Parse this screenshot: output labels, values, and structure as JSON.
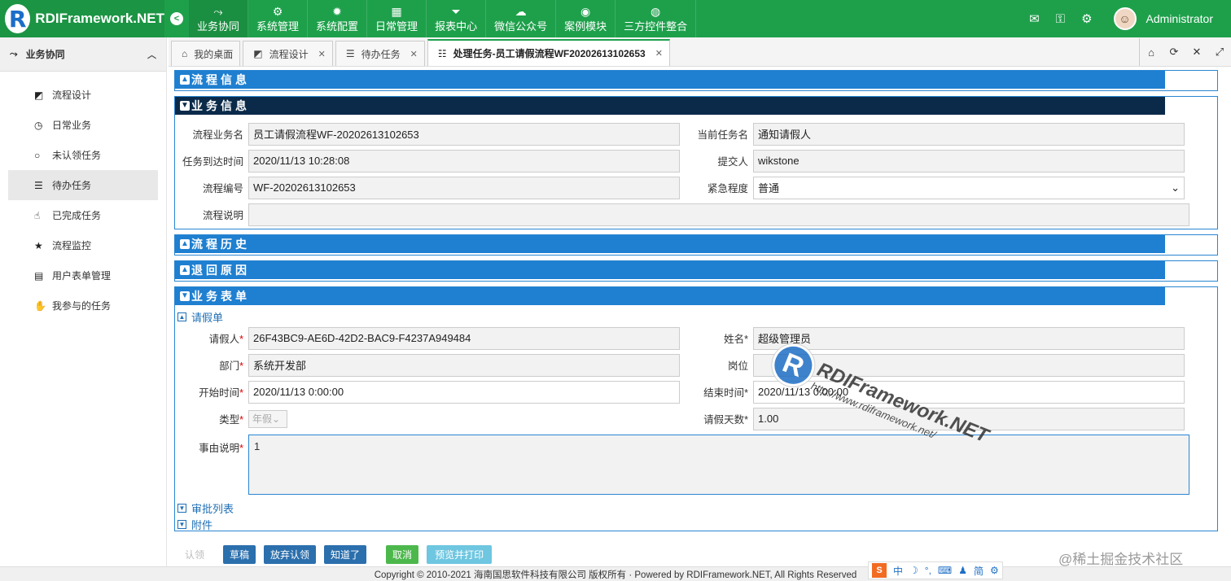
{
  "app": {
    "logo_letter": "R",
    "title": "RDIFramework.NET"
  },
  "nav": {
    "collapse_icon": "chevron-left",
    "items": [
      {
        "icon": "share-icon",
        "glyph": "⤳",
        "label": "业务协同",
        "active": true
      },
      {
        "icon": "cogs-icon",
        "glyph": "⚙",
        "label": "系统管理"
      },
      {
        "icon": "gear-icon",
        "glyph": "✹",
        "label": "系统配置"
      },
      {
        "icon": "calendar-icon",
        "glyph": "▦",
        "label": "日常管理"
      },
      {
        "icon": "filter-icon",
        "glyph": "⏷",
        "label": "报表中心"
      },
      {
        "icon": "wechat-icon",
        "glyph": "☁",
        "label": "微信公众号"
      },
      {
        "icon": "eye-icon",
        "glyph": "◉",
        "label": "案例模块"
      },
      {
        "icon": "globe-icon",
        "glyph": "◍",
        "label": "三方控件整合"
      }
    ],
    "right": {
      "mail": "✉",
      "key": "⚿",
      "settings": "⚙",
      "username": "Administrator"
    }
  },
  "sidebar": {
    "header": "业务协同",
    "items": [
      {
        "glyph": "◩",
        "label": "流程设计"
      },
      {
        "glyph": "◷",
        "label": "日常业务"
      },
      {
        "glyph": "○",
        "label": "未认领任务"
      },
      {
        "glyph": "☰",
        "label": "待办任务",
        "active": true
      },
      {
        "glyph": "☝",
        "label": "已完成任务"
      },
      {
        "glyph": "★",
        "label": "流程监控"
      },
      {
        "glyph": "▤",
        "label": "用户表单管理"
      },
      {
        "glyph": "✋",
        "label": "我参与的任务"
      }
    ]
  },
  "tabs": [
    {
      "glyph": "⌂",
      "label": "我的桌面",
      "closable": false
    },
    {
      "glyph": "◩",
      "label": "流程设计",
      "closable": true
    },
    {
      "glyph": "☰",
      "label": "待办任务",
      "closable": true
    },
    {
      "glyph": "☷",
      "label": "处理任务-员工请假流程WF20202613102653",
      "closable": true,
      "active": true
    }
  ],
  "tab_tools": [
    "⌂",
    "⟳",
    "✕",
    "⤢"
  ],
  "sections": {
    "flow_info": "流程信息",
    "biz_info": "业务信息",
    "flow_history": "流程历史",
    "return_reason": "退回原因",
    "biz_form": "业务表单"
  },
  "biz_info": {
    "flow_name_label": "流程业务名",
    "flow_name": "员工请假流程WF-20202613102653",
    "cur_task_label": "当前任务名",
    "cur_task": "通知请假人",
    "arrive_label": "任务到达时间",
    "arrive": "2020/11/13 10:28:08",
    "submitter_label": "提交人",
    "submitter": "wikstone",
    "flow_no_label": "流程编号",
    "flow_no": "WF-20202613102653",
    "urgency_label": "紧急程度",
    "urgency": "普通",
    "desc_label": "流程说明",
    "desc": ""
  },
  "leave_form": {
    "subsection": "请假单",
    "applicant_label": "请假人",
    "applicant": "26F43BC9-AE6D-42D2-BAC9-F4237A949484",
    "name_label": "姓名",
    "name": "超级管理员",
    "dept_label": "部门",
    "dept": "系统开发部",
    "post_label": "岗位",
    "post": "",
    "start_label": "开始时间",
    "start": "2020/11/13 0:00:00",
    "end_label": "结束时间",
    "end": "2020/11/13 0:00:00",
    "type_label": "类型",
    "type": "年假",
    "days_label": "请假天数",
    "days": "1.00",
    "reason_label": "事由说明",
    "reason": "1"
  },
  "subsections": {
    "approval_list": "审批列表",
    "attachments": "附件"
  },
  "toolbar": {
    "claim": "认领",
    "draft": "草稿",
    "abandon": "放弃认领",
    "known": "知道了",
    "cancel": "取消",
    "preview_print": "预览并打印"
  },
  "footer": {
    "copyright": "Copyright © 2010-2021 海南国思软件科技有限公司 版权所有 · Powered by RDIFramework.NET, All Rights Reserved"
  },
  "ime": {
    "logo": "S",
    "zh": "中",
    "moon": "☽",
    "dot": "°,",
    "kbd": "⌨",
    "user": "♟",
    "simp": "简",
    "gear": "⚙"
  },
  "juejin": "@稀土掘金技术社区",
  "watermark": {
    "letter": "R",
    "title": "RDIFramework.NET",
    "url": "http://www.rdiframework.net/"
  }
}
